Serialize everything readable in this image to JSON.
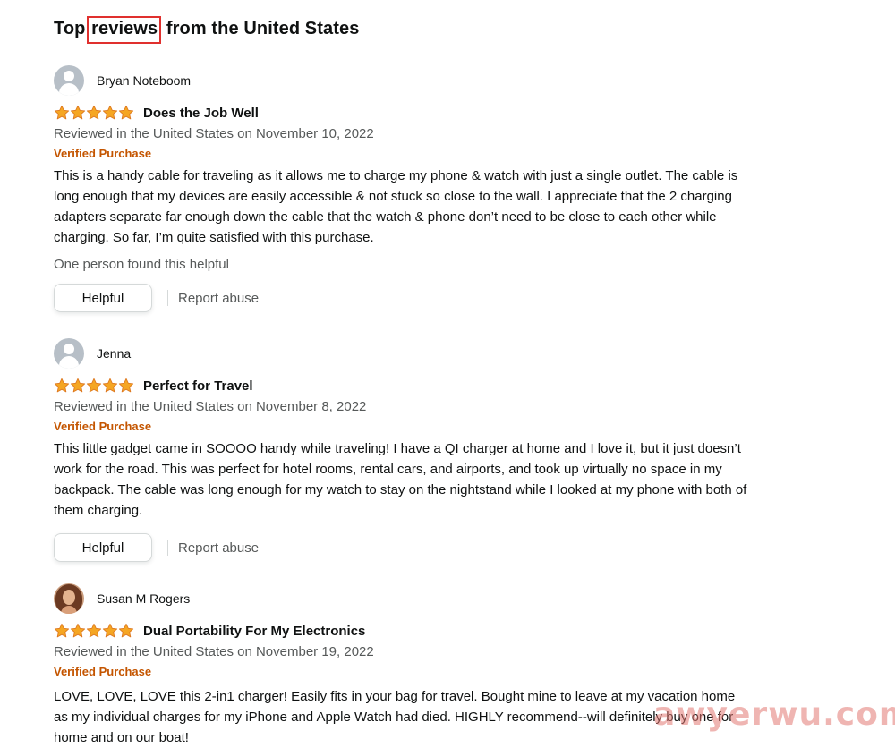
{
  "section": {
    "title_prefix": "Top ",
    "title_highlight": "reviews",
    "title_suffix": " from the United States"
  },
  "reviews": [
    {
      "author": "Bryan Noteboom",
      "avatar": "default-avatar",
      "rating": 5,
      "title": "Does the Job Well",
      "date": "Reviewed in the United States on November 10, 2022",
      "verified": "Verified Purchase",
      "body": "This is a handy cable for traveling as it allows me to charge my phone & watch with just a single outlet. The cable is long enough that my devices are easily accessible & not stuck so close to the wall. I appreciate that the 2 charging adapters separate far enough down the cable that the watch & phone don’t need to be close to each other while charging. So far, I’m quite satisfied with this purchase.",
      "helpful_count": "One person found this helpful",
      "helpful_label": "Helpful",
      "report_label": "Report abuse"
    },
    {
      "author": "Jenna",
      "avatar": "default-avatar",
      "rating": 5,
      "title": "Perfect for Travel",
      "date": "Reviewed in the United States on November 8, 2022",
      "verified": "Verified Purchase",
      "body": "This little gadget came in SOOOO handy while traveling! I have a QI charger at home and I love it, but it just doesn’t work for the road. This was perfect for hotel rooms, rental cars, and airports, and took up virtually no space in my backpack. The cable was long enough for my watch to stay on the nightstand while I looked at my phone with both of them charging.",
      "helpful_label": "Helpful",
      "report_label": "Report abuse"
    },
    {
      "author": "Susan M Rogers",
      "avatar": "photo-avatar",
      "rating": 5,
      "title": "Dual Portability For My Electronics",
      "date": "Reviewed in the United States on November 19, 2022",
      "verified": "Verified Purchase",
      "body": "LOVE, LOVE, LOVE this 2-in1 charger! Easily fits in your bag for travel. Bought mine to leave at my vacation home as my individual charges for my iPhone and Apple Watch had died. HIGHLY recommend--will definitely buy one for home and on our boat!"
    }
  ],
  "watermark": "awyerwu.com",
  "colors": {
    "star": "#f5a623",
    "star_outline": "#de7921",
    "verified": "#c45500",
    "highlight_box": "#e0302e",
    "secondary_text": "#565959"
  },
  "icons": {
    "star": "star-icon",
    "avatar": "user-avatar-icon"
  }
}
